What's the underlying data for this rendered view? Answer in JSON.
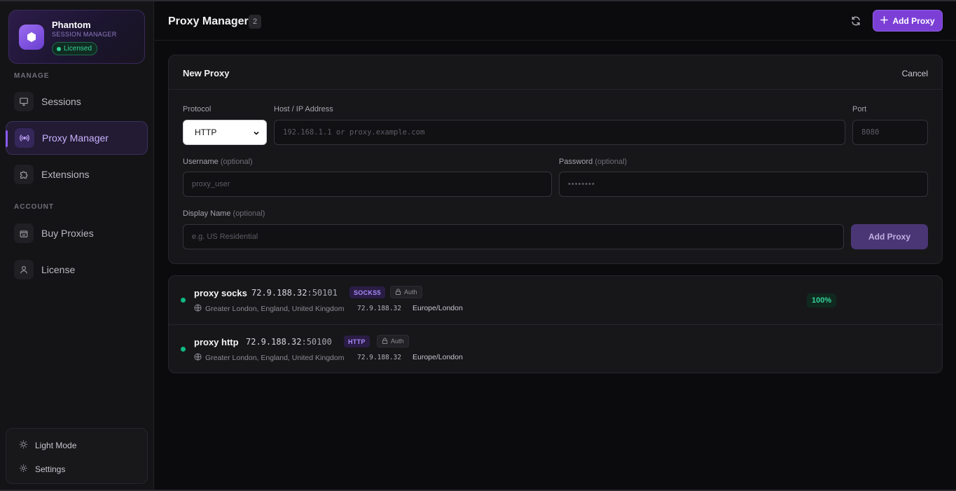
{
  "app": {
    "name": "Phantom",
    "subtitle": "SESSION MANAGER",
    "license_badge": "Licensed"
  },
  "sidebar": {
    "section_manage": "MANAGE",
    "section_account": "ACCOUNT",
    "items": [
      {
        "label": "Sessions",
        "icon": "monitor-icon",
        "active": false
      },
      {
        "label": "Proxy Manager",
        "icon": "broadcast-icon",
        "active": true
      },
      {
        "label": "Extensions",
        "icon": "puzzle-icon",
        "active": false
      },
      {
        "label": "Buy Proxies",
        "icon": "shopping-bag-icon",
        "active": false
      },
      {
        "label": "License",
        "icon": "user-icon",
        "active": false
      }
    ],
    "bottom": {
      "light_mode": "Light Mode",
      "settings": "Settings"
    }
  },
  "header": {
    "title": "Proxy Manager",
    "count": "2",
    "add_button": "Add Proxy"
  },
  "form": {
    "title": "New Proxy",
    "cancel": "Cancel",
    "protocol_label": "Protocol",
    "protocol_value": "HTTP",
    "host_label": "Host / IP Address",
    "host_placeholder": "192.168.1.1 or proxy.example.com",
    "port_label": "Port",
    "port_placeholder": "8080",
    "username_label": "Username",
    "username_optional": "(optional)",
    "username_placeholder": "proxy_user",
    "password_label": "Password",
    "password_optional": "(optional)",
    "password_placeholder": "••••••••",
    "display_label": "Display Name",
    "display_optional": "(optional)",
    "display_placeholder": "e.g. US Residential",
    "submit": "Add Proxy"
  },
  "proxies": [
    {
      "name": "proxy socks",
      "host": "72.9.188.32",
      "port": ":50101",
      "type": "SOCKS5",
      "auth": "Auth",
      "location": "Greater London, England, United Kingdom",
      "ip": "72.9.188.32",
      "timezone": "Europe/London",
      "uptime": "100%"
    },
    {
      "name": "proxy http",
      "host": "72.9.188.32",
      "port": ":50100",
      "type": "HTTP",
      "auth": "Auth",
      "location": "Greater London, England, United Kingdom",
      "ip": "72.9.188.32",
      "timezone": "Europe/London"
    }
  ],
  "colors": {
    "accent": "#7c3fd6",
    "status_online": "#10b981",
    "licensed": "#34d399"
  }
}
